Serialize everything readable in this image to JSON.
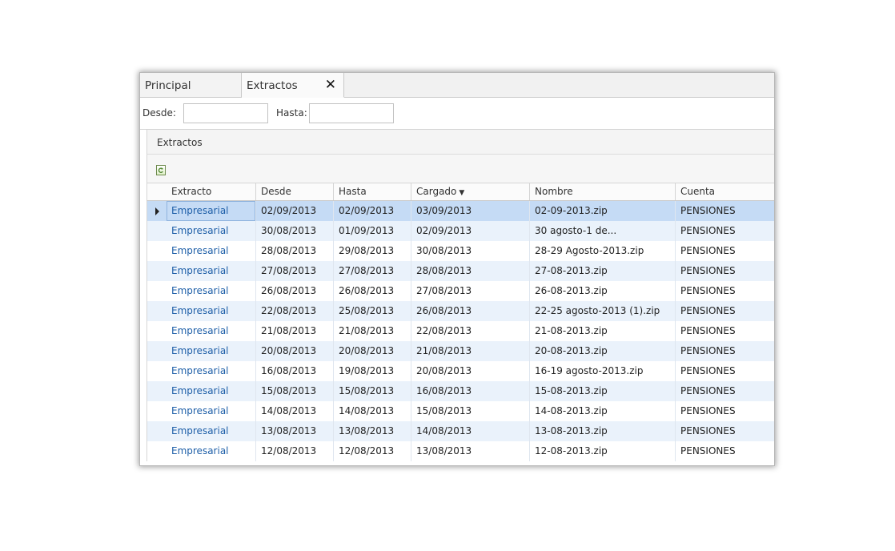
{
  "tabs": [
    {
      "label": "Principal"
    },
    {
      "label": "Extractos",
      "close": "✕"
    }
  ],
  "filters": {
    "desde_label": "Desde:",
    "desde_value": "",
    "hasta_label": "Hasta:",
    "hasta_value": ""
  },
  "panel": {
    "title": "Extractos"
  },
  "toolbar": {
    "refresh_icon": "refresh-icon"
  },
  "grid": {
    "columns": [
      "Extracto",
      "Desde",
      "Hasta",
      "Cargado",
      "Nombre",
      "Cuenta"
    ],
    "sort_indicator": "▼",
    "selected_row": 0,
    "rows": [
      [
        "Empresarial",
        "02/09/2013",
        "02/09/2013",
        "03/09/2013",
        "02-09-2013.zip",
        "PENSIONES"
      ],
      [
        "Empresarial",
        "30/08/2013",
        "01/09/2013",
        "02/09/2013",
        "30 agosto-1 de...",
        "PENSIONES"
      ],
      [
        "Empresarial",
        "28/08/2013",
        "29/08/2013",
        "30/08/2013",
        "28-29 Agosto-2013.zip",
        "PENSIONES"
      ],
      [
        "Empresarial",
        "27/08/2013",
        "27/08/2013",
        "28/08/2013",
        "27-08-2013.zip",
        "PENSIONES"
      ],
      [
        "Empresarial",
        "26/08/2013",
        "26/08/2013",
        "27/08/2013",
        "26-08-2013.zip",
        "PENSIONES"
      ],
      [
        "Empresarial",
        "22/08/2013",
        "25/08/2013",
        "26/08/2013",
        "22-25 agosto-2013 (1).zip",
        "PENSIONES"
      ],
      [
        "Empresarial",
        "21/08/2013",
        "21/08/2013",
        "22/08/2013",
        "21-08-2013.zip",
        "PENSIONES"
      ],
      [
        "Empresarial",
        "20/08/2013",
        "20/08/2013",
        "21/08/2013",
        "20-08-2013.zip",
        "PENSIONES"
      ],
      [
        "Empresarial",
        "16/08/2013",
        "19/08/2013",
        "20/08/2013",
        "16-19 agosto-2013.zip",
        "PENSIONES"
      ],
      [
        "Empresarial",
        "15/08/2013",
        "15/08/2013",
        "16/08/2013",
        "15-08-2013.zip",
        "PENSIONES"
      ],
      [
        "Empresarial",
        "14/08/2013",
        "14/08/2013",
        "15/08/2013",
        "14-08-2013.zip",
        "PENSIONES"
      ],
      [
        "Empresarial",
        "13/08/2013",
        "13/08/2013",
        "14/08/2013",
        "13-08-2013.zip",
        "PENSIONES"
      ],
      [
        "Empresarial",
        "12/08/2013",
        "12/08/2013",
        "13/08/2013",
        "12-08-2013.zip",
        "PENSIONES"
      ]
    ]
  }
}
